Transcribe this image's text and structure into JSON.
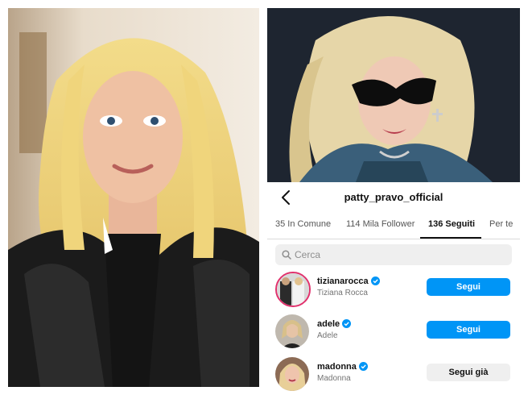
{
  "profile": {
    "username": "patty_pravo_official"
  },
  "tabs": [
    {
      "label": "35 In Comune"
    },
    {
      "label": "114 Mila Follower"
    },
    {
      "label": "136 Seguiti"
    },
    {
      "label": "Per te"
    }
  ],
  "search": {
    "placeholder": "Cerca"
  },
  "following": [
    {
      "username": "tizianarocca",
      "name": "Tiziana Rocca",
      "button": "Segui"
    },
    {
      "username": "adele",
      "name": "Adele",
      "button": "Segui"
    },
    {
      "username": "madonna",
      "name": "Madonna",
      "button": "Segui già"
    }
  ],
  "colors": {
    "accent": "#0095f6",
    "verified": "#0095f6"
  },
  "icons": {
    "back": "chevron-left-icon",
    "search": "search-icon",
    "verified": "verified-badge-icon"
  }
}
